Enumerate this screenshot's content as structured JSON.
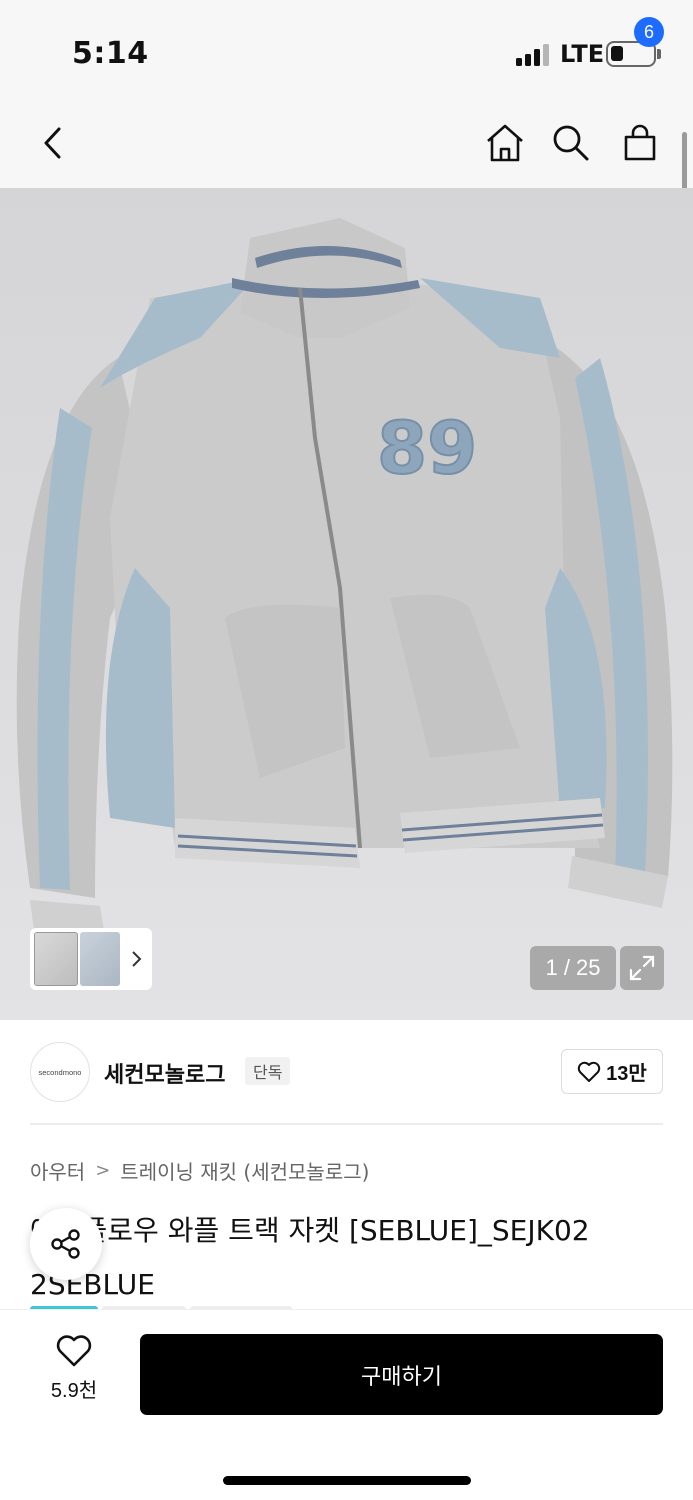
{
  "status_bar": {
    "time": "5:14",
    "network": "LTE"
  },
  "header": {
    "cart_count": "6"
  },
  "gallery": {
    "counter": "1 / 25",
    "jacket_number": "89",
    "colors": {
      "body": "#c9c9c9",
      "accent": "#a7bccb",
      "stripe": "#7c8ea3"
    }
  },
  "brand": {
    "logo_text": "secondmono",
    "name": "세컨모놀로그",
    "badge": "단독",
    "likes": "13만"
  },
  "breadcrumb": [
    "아우터",
    "트레이닝 재킷 (세컨모놀로그)"
  ],
  "product": {
    "title_line1": "에스플로우 와플 트랙 자켓 [SEBLUE]_SEJK02",
    "title_line2": "2SEBLUE"
  },
  "bottom_bar": {
    "wish_count": "5.9천",
    "buy_label": "구매하기"
  }
}
